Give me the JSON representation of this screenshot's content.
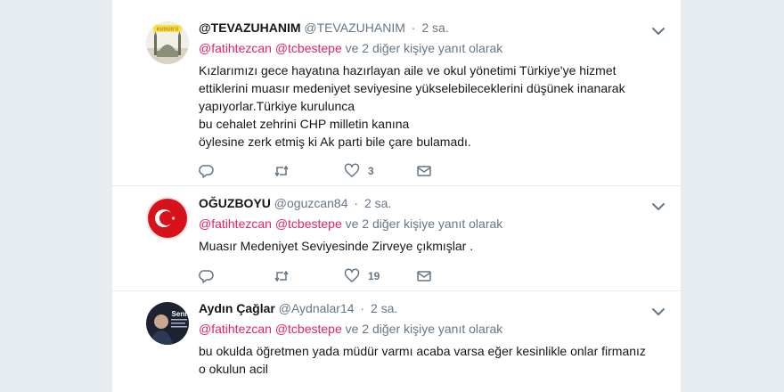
{
  "tweets": [
    {
      "fullname": "@TEVAZUHANIM",
      "username": "@TEVAZUHANIM",
      "separator": "·",
      "time": "2 sa.",
      "reply_prefix_1": "@fatihtezcan",
      "reply_prefix_2": "@tcbestepe",
      "reply_suffix": "ve 2 diğer kişiye yanıt olarak",
      "text_lines": [
        "Kızlarımızı gece hayatına hazırlayan aile ve okul yönetimi Türkiye'ye hizmet",
        "ettiklerini muasır medeniyet seviyesine yükselebileceklerini düşünek inanarak",
        "yapıyorlar.Türkiye kurulunca",
        "bu cehalet zehrini CHP milletin kanına",
        "öylesine zerk etmiş ki Ak parti bile çare bulamadı."
      ],
      "reply_count": "",
      "retweet_count": "",
      "like_count": "3",
      "avatar_icon": "mosque-logo-icon",
      "avatar_text": "KUDÜS'Ü"
    },
    {
      "fullname": "OĞUZBOYU",
      "username": "@oguzcan84",
      "separator": "·",
      "time": "2 sa.",
      "reply_prefix_1": "@fatihtezcan",
      "reply_prefix_2": "@tcbestepe",
      "reply_suffix": "ve 2 diğer kişiye yanıt olarak",
      "text_lines": [
        "Muasır Medeniyet Seviyesinde Zirveye çıkmışlar ."
      ],
      "reply_count": "",
      "retweet_count": "",
      "like_count": "19",
      "avatar_icon": "turkish-flag-icon"
    },
    {
      "fullname": "Aydın Çağlar",
      "username": "@Aydnalar14",
      "separator": "·",
      "time": "2 sa.",
      "reply_prefix_1": "@fatihtezcan",
      "reply_prefix_2": "@tcbestepe",
      "reply_suffix": "ve 2 diğer kişiye yanıt olarak",
      "text_lines": [
        "bu okulda öğretmen yada müdür varmı acaba varsa eğer kesinlikle onlar firmanız",
        "o okulun acil"
      ],
      "avatar_icon": "portrait-photo-icon",
      "avatar_text": "Seni"
    }
  ],
  "colors": {
    "mention": "#e0245e",
    "secondary_text": "#657786",
    "background": "#e6ecf0"
  }
}
